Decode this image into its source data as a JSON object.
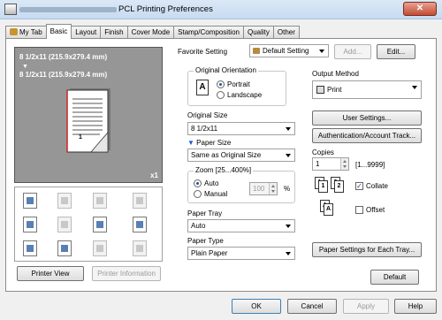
{
  "window": {
    "title": "PCL Printing Preferences",
    "close_glyph": "✕"
  },
  "tabs": [
    "My Tab",
    "Basic",
    "Layout",
    "Finish",
    "Cover Mode",
    "Stamp/Composition",
    "Quality",
    "Other"
  ],
  "preview": {
    "line1": "8 1/2x11 (215.9x279.4 mm)",
    "arrow": "▼",
    "line2": "8 1/2x11 (215.9x279.4 mm)",
    "page_number": "1",
    "copies_badge": "x1"
  },
  "preview_buttons": {
    "printer_view": "Printer View",
    "printer_information": "Printer Information"
  },
  "favorite": {
    "label": "Favorite Setting",
    "value": "Default Setting",
    "add": "Add...",
    "edit": "Edit..."
  },
  "orientation": {
    "legend": "Original Orientation",
    "portrait": "Portrait",
    "landscape": "Landscape",
    "icon_letter": "A"
  },
  "original_size": {
    "label": "Original Size",
    "value": "8 1/2x11"
  },
  "paper_size": {
    "label": "Paper Size",
    "value": "Same as Original Size"
  },
  "zoom": {
    "legend": "Zoom [25...400%]",
    "auto": "Auto",
    "manual": "Manual",
    "value": "100",
    "unit": "%"
  },
  "paper_tray": {
    "label": "Paper Tray",
    "value": "Auto"
  },
  "paper_type": {
    "label": "Paper Type",
    "value": "Plain Paper"
  },
  "output": {
    "label": "Output Method",
    "value": "Print"
  },
  "buttons": {
    "user_settings": "User Settings...",
    "auth": "Authentication/Account Track...",
    "paper_settings": "Paper Settings for Each Tray...",
    "default": "Default",
    "ok": "OK",
    "cancel": "Cancel",
    "apply": "Apply",
    "help": "Help"
  },
  "copies": {
    "label": "Copies",
    "value": "1",
    "range": "[1...9999]"
  },
  "collate": {
    "label": "Collate",
    "checked": true,
    "mark": "✓"
  },
  "offset": {
    "label": "Offset",
    "checked": false
  },
  "icons": {
    "copies_1": "1",
    "copies_2": "2",
    "offset_letter": "A"
  }
}
